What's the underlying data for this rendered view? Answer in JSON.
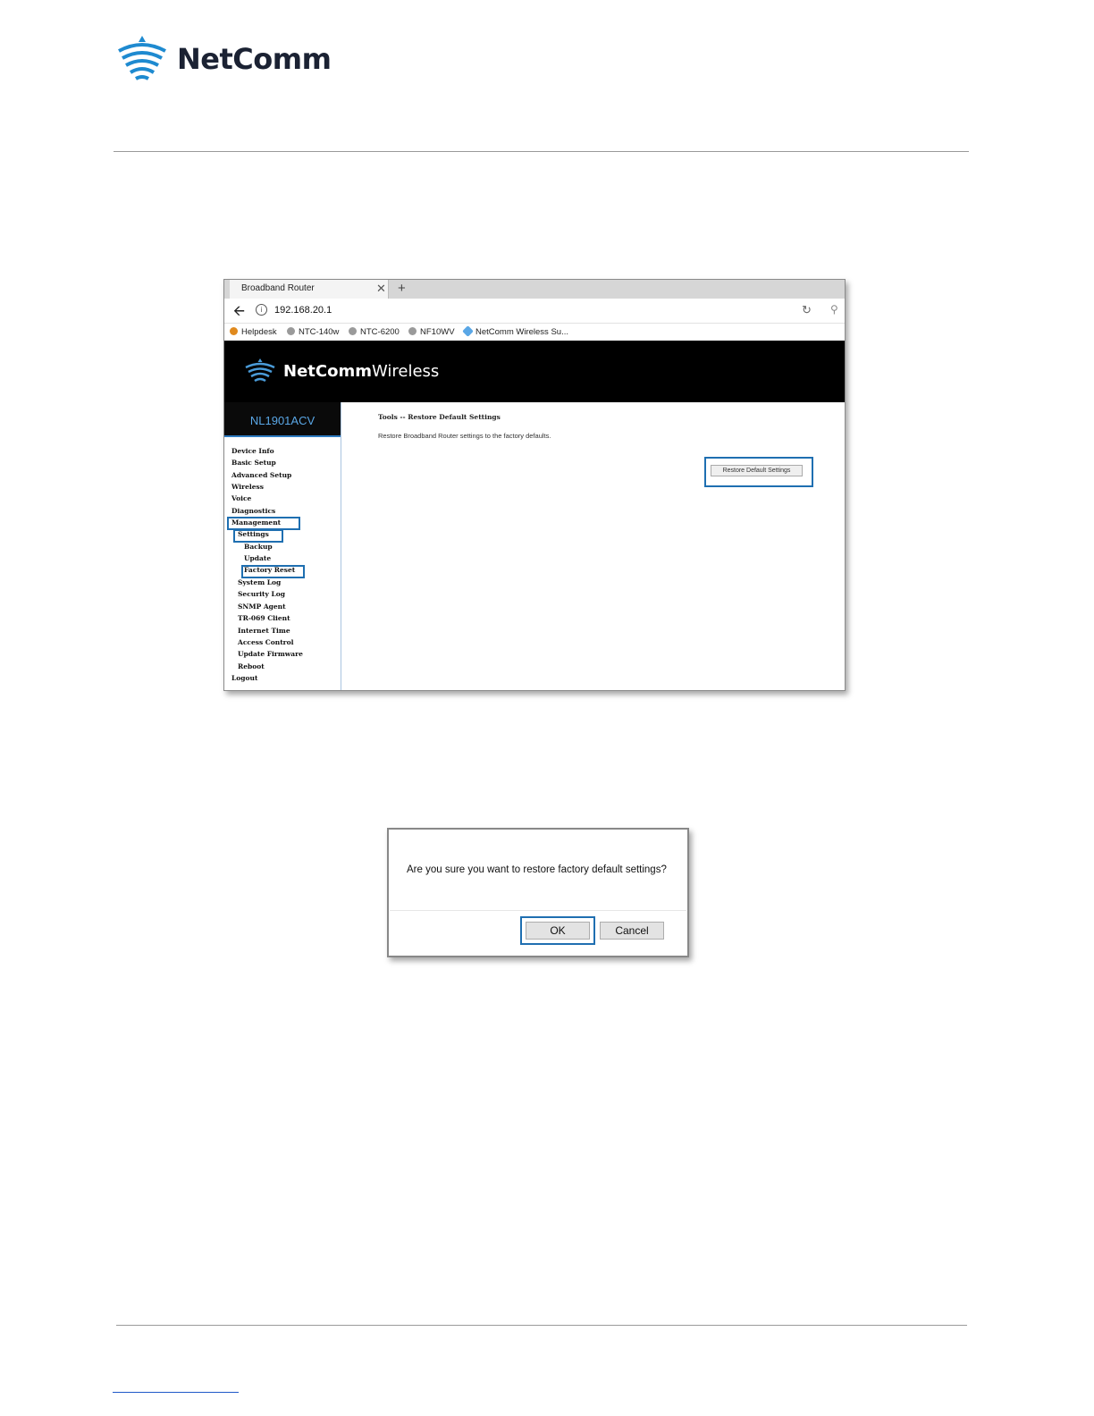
{
  "page_header": {
    "logo_text": "NetComm"
  },
  "browser": {
    "tab_title": "Broadband Router",
    "close_glyph": "✕",
    "new_tab_glyph": "+",
    "url": "192.168.20.1",
    "bookmarks": [
      "Helpdesk",
      "NTC-140w",
      "NTC-6200",
      "NF10WV",
      "NetComm Wireless Su..."
    ]
  },
  "router_ui": {
    "brand_bold": "NetComm",
    "brand_regular": "Wireless",
    "model": "NL1901ACV",
    "nav": {
      "device_info": "Device Info",
      "basic_setup": "Basic Setup",
      "advanced_setup": "Advanced Setup",
      "wireless": "Wireless",
      "voice": "Voice",
      "diagnostics": "Diagnostics",
      "management": "Management",
      "settings": "Settings",
      "backup": "Backup",
      "update": "Update",
      "factory_reset": "Factory Reset",
      "system_log": "System Log",
      "security_log": "Security Log",
      "snmp_agent": "SNMP Agent",
      "tr069_client": "TR-069 Client",
      "internet_time": "Internet Time",
      "access_control": "Access Control",
      "update_firmware": "Update Firmware",
      "reboot": "Reboot",
      "logout": "Logout"
    },
    "breadcrumb": "Tools -- Restore Default Settings",
    "description": "Restore Broadband Router settings to the factory defaults.",
    "restore_button": "Restore Default Settings"
  },
  "dialog": {
    "message": "Are you sure you want to restore factory default settings?",
    "ok": "OK",
    "cancel": "Cancel"
  },
  "colors": {
    "highlight": "#1f6fb1",
    "model_text": "#5aa7e6",
    "logo_blue": "#1e8ad0"
  }
}
